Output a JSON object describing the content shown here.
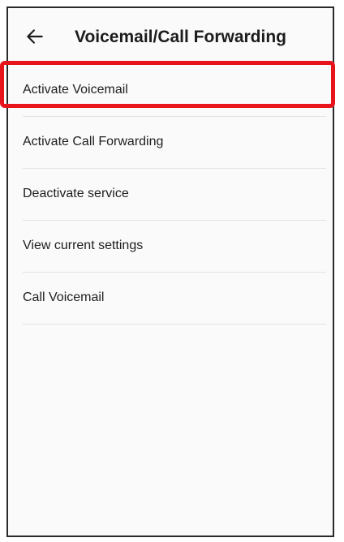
{
  "header": {
    "title": "Voicemail/Call Forwarding",
    "back_icon": "arrow-left-icon"
  },
  "menu": {
    "items": [
      {
        "label": "Activate Voicemail"
      },
      {
        "label": "Activate Call Forwarding"
      },
      {
        "label": "Deactivate service"
      },
      {
        "label": "View current settings"
      },
      {
        "label": "Call Voicemail"
      }
    ]
  },
  "colors": {
    "highlight": "#e8141b",
    "background": "#fafafa",
    "text": "#202020"
  }
}
